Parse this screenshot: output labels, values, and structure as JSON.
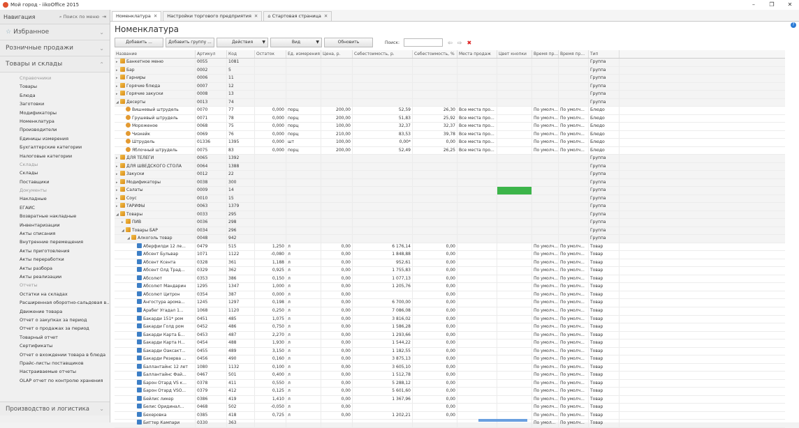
{
  "window": {
    "title": "Мой город - iikoOffice 2015",
    "controls": [
      "–",
      "❐",
      "✕"
    ]
  },
  "sidebar": {
    "title": "Навигация",
    "search": "Поиск по меню",
    "favorites": "Избранное",
    "retail": "Розничные продажи",
    "goods": "Товары и склады",
    "bottom": "Производство и логистика",
    "groups": [
      {
        "title": "Справочники",
        "items": [
          "Товары",
          "Блюда",
          "Заготовки",
          "Модификаторы",
          "Номенклатура",
          "Производители",
          "Единицы измерения",
          "Бухгалтерские категории",
          "Налоговые категории"
        ]
      },
      {
        "title": "Склады",
        "items": [
          "Склады",
          "Поставщики"
        ]
      },
      {
        "title": "Документы",
        "items": [
          "Накладные",
          "ЕГАИС",
          "Возвратные накладные",
          "Инвентаризации",
          "Акты списания",
          "Внутренние перемещения",
          "Акты приготовления",
          "Акты переработки",
          "Акты разбора",
          "Акты реализации"
        ]
      },
      {
        "title": "Отчеты",
        "items": [
          "Остатки на складах",
          "Расширенная оборотно-сальдовая в...",
          "Движение товара",
          "Отчет о закупках за период",
          "Отчет о продажах за период",
          "Товарный отчет",
          "Сертификаты",
          "Отчет о вхождении товара в блюда",
          "Прайс-листы поставщиков",
          "Настраиваемые отчеты",
          "OLAP отчет по контролю хранения"
        ]
      }
    ]
  },
  "tabs": [
    {
      "label": "Номенклатура"
    },
    {
      "label": "Настройки торгового предприятия"
    },
    {
      "label": "Стартовая страница"
    }
  ],
  "page_title": "Номенклатура",
  "toolbar": {
    "add": "Добавить ...",
    "add_group": "Добавить группу ...",
    "actions": "Действия",
    "view": "Вид",
    "refresh": "Обновить",
    "search_label": "Поиск:"
  },
  "columns": [
    "Название",
    "Артикул",
    "Код",
    "Остаток",
    "Ед. измерения",
    "Цена, р.",
    "Себестоимость, р.",
    "Себестоимость, %",
    "Места продаж",
    "Цвет кнопки",
    "Время пр...",
    "Время пр...",
    "Тип"
  ],
  "rows": [
    {
      "lvl": 0,
      "icon": "folder",
      "tw": "▸",
      "name": "Банкетное меню",
      "art": "0055",
      "code": "1081",
      "ost": "",
      "ed": "",
      "price": "",
      "seb": "",
      "sebp": "",
      "place": "",
      "t1": "",
      "t2": "",
      "type": "Группа"
    },
    {
      "lvl": 0,
      "icon": "folder",
      "tw": "▸",
      "name": "Бар",
      "art": "0002",
      "code": "5",
      "ost": "",
      "ed": "",
      "price": "",
      "seb": "",
      "sebp": "",
      "place": "",
      "t1": "",
      "t2": "",
      "type": "Группа"
    },
    {
      "lvl": 0,
      "icon": "folder",
      "tw": "▸",
      "name": "Гарниры",
      "art": "0006",
      "code": "11",
      "ost": "",
      "ed": "",
      "price": "",
      "seb": "",
      "sebp": "",
      "place": "",
      "t1": "",
      "t2": "",
      "type": "Группа"
    },
    {
      "lvl": 0,
      "icon": "folder",
      "tw": "▸",
      "name": "Горячие блюда",
      "art": "0007",
      "code": "12",
      "ost": "",
      "ed": "",
      "price": "",
      "seb": "",
      "sebp": "",
      "place": "",
      "t1": "",
      "t2": "",
      "type": "Группа"
    },
    {
      "lvl": 0,
      "icon": "folder",
      "tw": "▸",
      "name": "Горячие закуски",
      "art": "0008",
      "code": "13",
      "ost": "",
      "ed": "",
      "price": "",
      "seb": "",
      "sebp": "",
      "place": "",
      "t1": "",
      "t2": "",
      "type": "Группа"
    },
    {
      "lvl": 0,
      "icon": "folder",
      "tw": "◢",
      "name": "Десерты",
      "art": "0013",
      "code": "74",
      "ost": "",
      "ed": "",
      "price": "",
      "seb": "",
      "sebp": "",
      "place": "",
      "t1": "",
      "t2": "",
      "type": "Группа"
    },
    {
      "lvl": 1,
      "icon": "dish",
      "tw": "",
      "name": "Вишневый штрудель",
      "art": "0070",
      "code": "77",
      "ost": "0,000",
      "ed": "порц",
      "price": "200,00",
      "seb": "52,59",
      "sebp": "26,30",
      "place": "Все места про...",
      "t1": "По умолч...",
      "t2": "По умолч...",
      "type": "Блюдо"
    },
    {
      "lvl": 1,
      "icon": "dish",
      "tw": "",
      "name": "Грушевый штрудель",
      "art": "0071",
      "code": "78",
      "ost": "0,000",
      "ed": "порц",
      "price": "200,00",
      "seb": "51,83",
      "sebp": "25,92",
      "place": "Все места про...",
      "t1": "По умолч...",
      "t2": "По умолч...",
      "type": "Блюдо"
    },
    {
      "lvl": 1,
      "icon": "dish",
      "tw": "",
      "name": "Мороженое",
      "art": "0068",
      "code": "75",
      "ost": "0,000",
      "ed": "порц",
      "price": "100,00",
      "seb": "32,37",
      "sebp": "32,37",
      "place": "Все места про...",
      "t1": "По умолч...",
      "t2": "По умолч...",
      "type": "Блюдо"
    },
    {
      "lvl": 1,
      "icon": "dish",
      "tw": "",
      "name": "Чизкейк",
      "art": "0069",
      "code": "76",
      "ost": "0,000",
      "ed": "порц",
      "price": "210,00",
      "seb": "83,53",
      "sebp": "39,78",
      "place": "Все места про...",
      "t1": "По умолч...",
      "t2": "По умолч...",
      "type": "Блюдо"
    },
    {
      "lvl": 1,
      "icon": "dish",
      "tw": "",
      "name": "Штрудель",
      "art": "01336",
      "code": "1395",
      "ost": "0,000",
      "ed": "шт",
      "price": "100,00",
      "seb": "0,00*",
      "sebp": "0,00",
      "place": "Все места про...",
      "t1": "По умолч...",
      "t2": "По умолч...",
      "type": "Блюдо"
    },
    {
      "lvl": 1,
      "icon": "dish",
      "tw": "",
      "name": "Яблочный штрудель",
      "art": "0075",
      "code": "83",
      "ost": "0,000",
      "ed": "порц",
      "price": "200,00",
      "seb": "52,49",
      "sebp": "26,25",
      "place": "Все места про...",
      "t1": "По умолч...",
      "t2": "По умолч...",
      "type": "Блюдо"
    },
    {
      "lvl": 0,
      "icon": "folder",
      "tw": "▸",
      "name": "ДЛЯ ТЕЛЕГИ",
      "art": "0065",
      "code": "1392",
      "ost": "",
      "ed": "",
      "price": "",
      "seb": "",
      "sebp": "",
      "place": "",
      "t1": "",
      "t2": "",
      "type": "Группа"
    },
    {
      "lvl": 0,
      "icon": "folder",
      "tw": "▸",
      "name": "ДЛЯ ШВЕДСКОГО СТОЛА",
      "art": "0064",
      "code": "1388",
      "ost": "",
      "ed": "",
      "price": "",
      "seb": "",
      "sebp": "",
      "place": "",
      "t1": "",
      "t2": "",
      "type": "Группа"
    },
    {
      "lvl": 0,
      "icon": "folder",
      "tw": "▸",
      "name": "Закуски",
      "art": "0012",
      "code": "22",
      "ost": "",
      "ed": "",
      "price": "",
      "seb": "",
      "sebp": "",
      "place": "",
      "t1": "",
      "t2": "",
      "type": "Группа"
    },
    {
      "lvl": 0,
      "icon": "folder",
      "tw": "▸",
      "name": "Модификаторы",
      "art": "0038",
      "code": "300",
      "ost": "",
      "ed": "",
      "price": "",
      "seb": "",
      "sebp": "",
      "place": "",
      "t1": "",
      "t2": "",
      "type": "Группа"
    },
    {
      "lvl": 0,
      "icon": "folder",
      "tw": "▸",
      "name": "Салаты",
      "art": "0009",
      "code": "14",
      "ost": "",
      "ed": "",
      "price": "",
      "seb": "",
      "sebp": "",
      "place": "",
      "t1": "",
      "t2": "",
      "type": "Группа",
      "green": true
    },
    {
      "lvl": 0,
      "icon": "folder",
      "tw": "▸",
      "name": "Соус",
      "art": "0010",
      "code": "15",
      "ost": "",
      "ed": "",
      "price": "",
      "seb": "",
      "sebp": "",
      "place": "",
      "t1": "",
      "t2": "",
      "type": "Группа"
    },
    {
      "lvl": 0,
      "icon": "folder",
      "tw": "▸",
      "name": "ТАРИФЫ",
      "art": "0063",
      "code": "1379",
      "ost": "",
      "ed": "",
      "price": "",
      "seb": "",
      "sebp": "",
      "place": "",
      "t1": "",
      "t2": "",
      "type": "Группа"
    },
    {
      "lvl": 0,
      "icon": "folder",
      "tw": "◢",
      "name": "Товары",
      "art": "0033",
      "code": "295",
      "ost": "",
      "ed": "",
      "price": "",
      "seb": "",
      "sebp": "",
      "place": "",
      "t1": "",
      "t2": "",
      "type": "Группа"
    },
    {
      "lvl": 1,
      "icon": "folder",
      "tw": "▸",
      "name": "ПИВ",
      "art": "0036",
      "code": "298",
      "ost": "",
      "ed": "",
      "price": "",
      "seb": "",
      "sebp": "",
      "place": "",
      "t1": "",
      "t2": "",
      "type": "Группа"
    },
    {
      "lvl": 1,
      "icon": "folder",
      "tw": "◢",
      "name": "Товары БАР",
      "art": "0034",
      "code": "296",
      "ost": "",
      "ed": "",
      "price": "",
      "seb": "",
      "sebp": "",
      "place": "",
      "t1": "",
      "t2": "",
      "type": "Группа"
    },
    {
      "lvl": 2,
      "icon": "folder",
      "tw": "◢",
      "name": "Алкоголь товар",
      "art": "0048",
      "code": "942",
      "ost": "",
      "ed": "",
      "price": "",
      "seb": "",
      "sebp": "",
      "place": "",
      "t1": "",
      "t2": "",
      "type": "Группа"
    },
    {
      "lvl": 3,
      "icon": "good",
      "tw": "",
      "name": "Аберфилди 12 ле...",
      "art": "0479",
      "code": "515",
      "ost": "1,250",
      "ed": "л",
      "price": "0,00",
      "seb": "6 176,14",
      "sebp": "0,00",
      "place": "",
      "t1": "По умолч...",
      "t2": "По умолч...",
      "type": "Товар"
    },
    {
      "lvl": 3,
      "icon": "good",
      "tw": "",
      "name": "Абсент Бульвар",
      "art": "1071",
      "code": "1122",
      "ost": "-0,080",
      "ed": "л",
      "price": "0,00",
      "seb": "1 848,88",
      "sebp": "0,00",
      "place": "",
      "t1": "По умолч...",
      "t2": "По умолч...",
      "type": "Товар"
    },
    {
      "lvl": 3,
      "icon": "good",
      "tw": "",
      "name": "Абсент Ксента",
      "art": "0328",
      "code": "361",
      "ost": "1,188",
      "ed": "л",
      "price": "0,00",
      "seb": "952,61",
      "sebp": "0,00",
      "place": "",
      "t1": "По умолч...",
      "t2": "По умолч...",
      "type": "Товар"
    },
    {
      "lvl": 3,
      "icon": "good",
      "tw": "",
      "name": "Абсент Олд Трад...",
      "art": "0329",
      "code": "362",
      "ost": "0,925",
      "ed": "л",
      "price": "0,00",
      "seb": "1 755,83",
      "sebp": "0,00",
      "place": "",
      "t1": "По умолч...",
      "t2": "По умолч...",
      "type": "Товар"
    },
    {
      "lvl": 3,
      "icon": "good",
      "tw": "",
      "name": "Абсолют",
      "art": "0353",
      "code": "386",
      "ost": "0,150",
      "ed": "л",
      "price": "0,00",
      "seb": "1 077,13",
      "sebp": "0,00",
      "place": "",
      "t1": "По умолч...",
      "t2": "По умолч...",
      "type": "Товар"
    },
    {
      "lvl": 3,
      "icon": "good",
      "tw": "",
      "name": "Абсолют Мандарин",
      "art": "1295",
      "code": "1347",
      "ost": "1,000",
      "ed": "л",
      "price": "0,00",
      "seb": "1 205,76",
      "sebp": "0,00",
      "place": "",
      "t1": "По умолч...",
      "t2": "По умолч...",
      "type": "Товар"
    },
    {
      "lvl": 3,
      "icon": "good",
      "tw": "",
      "name": "Абсолют Цитрон",
      "art": "0354",
      "code": "387",
      "ost": "0,000",
      "ed": "л",
      "price": "0,00",
      "seb": "",
      "sebp": "0,00",
      "place": "",
      "t1": "По умолч...",
      "t2": "По умолч...",
      "type": "Товар"
    },
    {
      "lvl": 3,
      "icon": "good",
      "tw": "",
      "name": "Ангостура арома...",
      "art": "1245",
      "code": "1297",
      "ost": "0,198",
      "ed": "л",
      "price": "0,00",
      "seb": "6 700,00",
      "sebp": "0,00",
      "place": "",
      "t1": "По умолч...",
      "t2": "По умолч...",
      "type": "Товар"
    },
    {
      "lvl": 3,
      "icon": "good",
      "tw": "",
      "name": "Арабег Угадал 1...",
      "art": "1068",
      "code": "1120",
      "ost": "0,250",
      "ed": "л",
      "price": "0,00",
      "seb": "7 086,08",
      "sebp": "0,00",
      "place": "",
      "t1": "По умолч...",
      "t2": "По умолч...",
      "type": "Товар"
    },
    {
      "lvl": 3,
      "icon": "good",
      "tw": "",
      "name": "Бакарди 151* ром",
      "art": "0451",
      "code": "485",
      "ost": "1,075",
      "ed": "л",
      "price": "0,00",
      "seb": "3 816,02",
      "sebp": "0,00",
      "place": "",
      "t1": "По умолч...",
      "t2": "По умолч...",
      "type": "Товар"
    },
    {
      "lvl": 3,
      "icon": "good",
      "tw": "",
      "name": "Бакарди Голд ром",
      "art": "0452",
      "code": "486",
      "ost": "0,750",
      "ed": "л",
      "price": "0,00",
      "seb": "1 586,28",
      "sebp": "0,00",
      "place": "",
      "t1": "По умолч...",
      "t2": "По умолч...",
      "type": "Товар"
    },
    {
      "lvl": 3,
      "icon": "good",
      "tw": "",
      "name": "Бакарди Карта Б...",
      "art": "0453",
      "code": "487",
      "ost": "2,270",
      "ed": "л",
      "price": "0,00",
      "seb": "1 293,66",
      "sebp": "0,00",
      "place": "",
      "t1": "По умолч...",
      "t2": "По умолч...",
      "type": "Товар"
    },
    {
      "lvl": 3,
      "icon": "good",
      "tw": "",
      "name": "Бакарди Карта Н...",
      "art": "0454",
      "code": "488",
      "ost": "1,930",
      "ed": "л",
      "price": "0,00",
      "seb": "1 544,22",
      "sebp": "0,00",
      "place": "",
      "t1": "По умолч...",
      "t2": "По умолч...",
      "type": "Товар"
    },
    {
      "lvl": 3,
      "icon": "good",
      "tw": "",
      "name": "Бакарди Оаксакт...",
      "art": "0455",
      "code": "489",
      "ost": "3,150",
      "ed": "л",
      "price": "0,00",
      "seb": "1 182,55",
      "sebp": "0,00",
      "place": "",
      "t1": "По умолч...",
      "t2": "По умолч...",
      "type": "Товар"
    },
    {
      "lvl": 3,
      "icon": "good",
      "tw": "",
      "name": "Бакарди Резерва ...",
      "art": "0456",
      "code": "490",
      "ost": "0,160",
      "ed": "л",
      "price": "0,00",
      "seb": "3 875,13",
      "sebp": "0,00",
      "place": "",
      "t1": "По умолч...",
      "t2": "По умолч...",
      "type": "Товар"
    },
    {
      "lvl": 3,
      "icon": "good",
      "tw": "",
      "name": "Баллантайнс 12 лет",
      "art": "1080",
      "code": "1132",
      "ost": "0,100",
      "ed": "л",
      "price": "0,00",
      "seb": "3 605,10",
      "sebp": "0,00",
      "place": "",
      "t1": "По умолч...",
      "t2": "По умолч...",
      "type": "Товар"
    },
    {
      "lvl": 3,
      "icon": "good",
      "tw": "",
      "name": "Баллантайнс Фай...",
      "art": "0467",
      "code": "501",
      "ost": "0,400",
      "ed": "л",
      "price": "0,00",
      "seb": "1 512,78",
      "sebp": "0,00",
      "place": "",
      "t1": "По умолч...",
      "t2": "По умолч...",
      "type": "Товар"
    },
    {
      "lvl": 3,
      "icon": "good",
      "tw": "",
      "name": "Барон Отард VS к...",
      "art": "0378",
      "code": "411",
      "ost": "0,550",
      "ed": "л",
      "price": "0,00",
      "seb": "5 288,12",
      "sebp": "0,00",
      "place": "",
      "t1": "По умолч...",
      "t2": "По умолч...",
      "type": "Товар"
    },
    {
      "lvl": 3,
      "icon": "good",
      "tw": "",
      "name": "Барон Отард VSO...",
      "art": "0379",
      "code": "412",
      "ost": "0,125",
      "ed": "л",
      "price": "0,00",
      "seb": "5 601,60",
      "sebp": "0,00",
      "place": "",
      "t1": "По умолч...",
      "t2": "По умолч...",
      "type": "Товар"
    },
    {
      "lvl": 3,
      "icon": "good",
      "tw": "",
      "name": "Бейлис ликер",
      "art": "0386",
      "code": "419",
      "ost": "1,410",
      "ed": "л",
      "price": "0,00",
      "seb": "1 367,96",
      "sebp": "0,00",
      "place": "",
      "t1": "По умолч...",
      "t2": "По умолч...",
      "type": "Товар"
    },
    {
      "lvl": 3,
      "icon": "good",
      "tw": "",
      "name": "Белис Оридинал...",
      "art": "0468",
      "code": "502",
      "ost": "-0,050",
      "ed": "л",
      "price": "0,00",
      "seb": "",
      "sebp": "0,00",
      "place": "",
      "t1": "По умолч...",
      "t2": "По умолч...",
      "type": "Товар"
    },
    {
      "lvl": 3,
      "icon": "good",
      "tw": "",
      "name": "Бехеровка",
      "art": "0385",
      "code": "418",
      "ost": "0,725",
      "ed": "л",
      "price": "0,00",
      "seb": "1 202,21",
      "sebp": "0,00",
      "place": "",
      "t1": "По умолч...",
      "t2": "По умолч...",
      "type": "Товар"
    },
    {
      "lvl": 3,
      "icon": "good",
      "tw": "",
      "name": "Биттер Кампари",
      "art": "0330",
      "code": "363",
      "ost": "",
      "ed": "",
      "price": "",
      "seb": "",
      "sebp": "",
      "place": "",
      "t1": "По умол...",
      "t2": "По умолч...",
      "type": "Товар"
    }
  ]
}
